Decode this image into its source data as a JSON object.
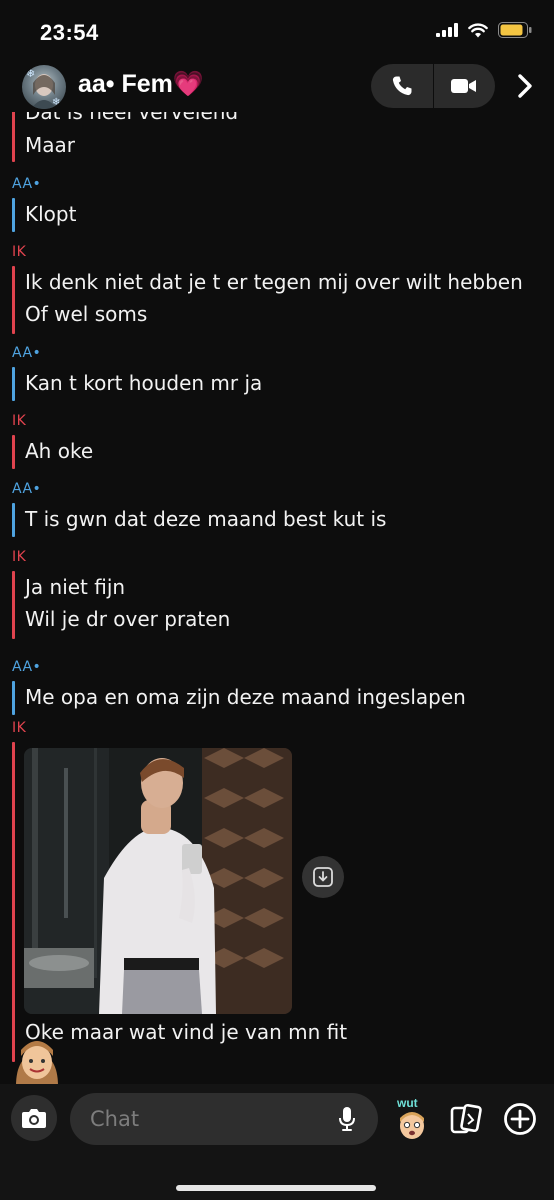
{
  "status_bar": {
    "time": "23:54"
  },
  "header": {
    "contact_name": "aa• Fem💗"
  },
  "messages": {
    "group1": {
      "line_partial": "Dat is heel vervelend",
      "line2": "Maar"
    },
    "group2": {
      "sender": "AA•",
      "line1": "Klopt"
    },
    "group3": {
      "sender": "IK",
      "line1": "Ik denk niet dat je t er tegen mij over wilt hebben",
      "line2": "Of wel soms"
    },
    "group4": {
      "sender": "AA•",
      "line1": "Kan t kort houden mr ja"
    },
    "group5": {
      "sender": "IK",
      "line1": "Ah oke"
    },
    "group6": {
      "sender": "AA•",
      "line1": "T is gwn dat deze maand best kut is"
    },
    "group7": {
      "sender": "IK",
      "line1": "Ja niet fijn",
      "line2": "Wil je dr over praten"
    },
    "group8": {
      "sender": "AA•",
      "line1": "Me opa en oma zijn deze maand ingeslapen"
    },
    "group9": {
      "sender": "IK",
      "caption": "Oke maar wat vind je van mn fit"
    }
  },
  "composer": {
    "placeholder": "Chat",
    "bitmoji_sticker_text": "wut"
  },
  "colors": {
    "friend_accent": "#4fa3e0",
    "me_accent": "#e0434e",
    "background": "#0d0d0d"
  },
  "icons": [
    "signal-icon",
    "wifi-icon",
    "battery-icon",
    "phone-icon",
    "video-icon",
    "chevron-right-icon",
    "download-icon",
    "camera-icon",
    "microphone-icon",
    "cards-icon",
    "plus-icon"
  ]
}
